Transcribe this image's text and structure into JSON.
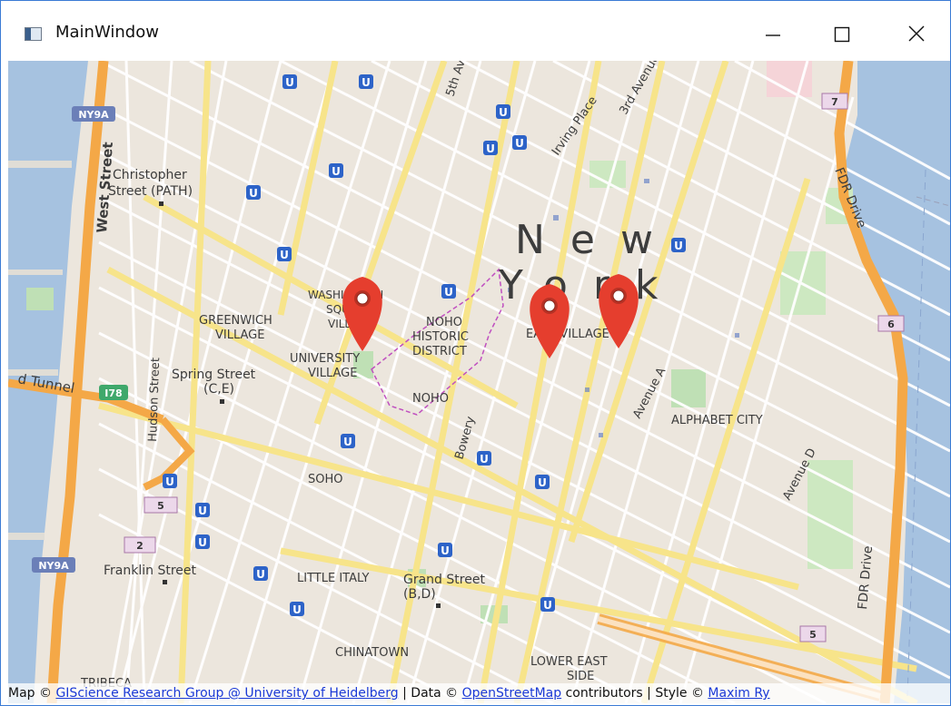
{
  "window": {
    "title": "MainWindow",
    "controls": [
      "minimize",
      "maximize",
      "close"
    ]
  },
  "map": {
    "city_label": "New York",
    "neighborhoods": [
      "Christopher Street (PATH)",
      "GREENWICH VILLAGE",
      "WASHINGTON SQUARE VILLAGE",
      "UNIVERSITY VILLAGE",
      "NOHO HISTORIC DISTRICT",
      "NOHO",
      "EAST VILLAGE",
      "ALPHABET CITY",
      "SOHO",
      "LITTLE ITALY",
      "CHINATOWN",
      "LOWER EAST SIDE",
      "TRIBECA",
      "Spring Street (C,E)",
      "Franklin Street",
      "Grand Street (B,D)"
    ],
    "streets": [
      "West Street",
      "Hudson Street",
      "5th Av",
      "Irving Place",
      "3rd Avenue",
      "Bowery",
      "Avenue A",
      "Avenue D",
      "FDR Drive"
    ],
    "shields": [
      "NY9A",
      "I78",
      "7",
      "6",
      "5",
      "2",
      "NY9A",
      "5",
      "5"
    ],
    "tunnel_label": "d Tunnel",
    "marker_count": 3,
    "marker_color": "#e53e2e",
    "water_color": "#a6c2e0"
  },
  "attribution": {
    "prefix": "Map ©",
    "link1": "GIScience Research Group @ University of Heidelberg",
    "mid": "| Data ©",
    "link2": "OpenStreetMap",
    "suffix": "contributors | Style ©",
    "link3": "Maxim Ry"
  }
}
